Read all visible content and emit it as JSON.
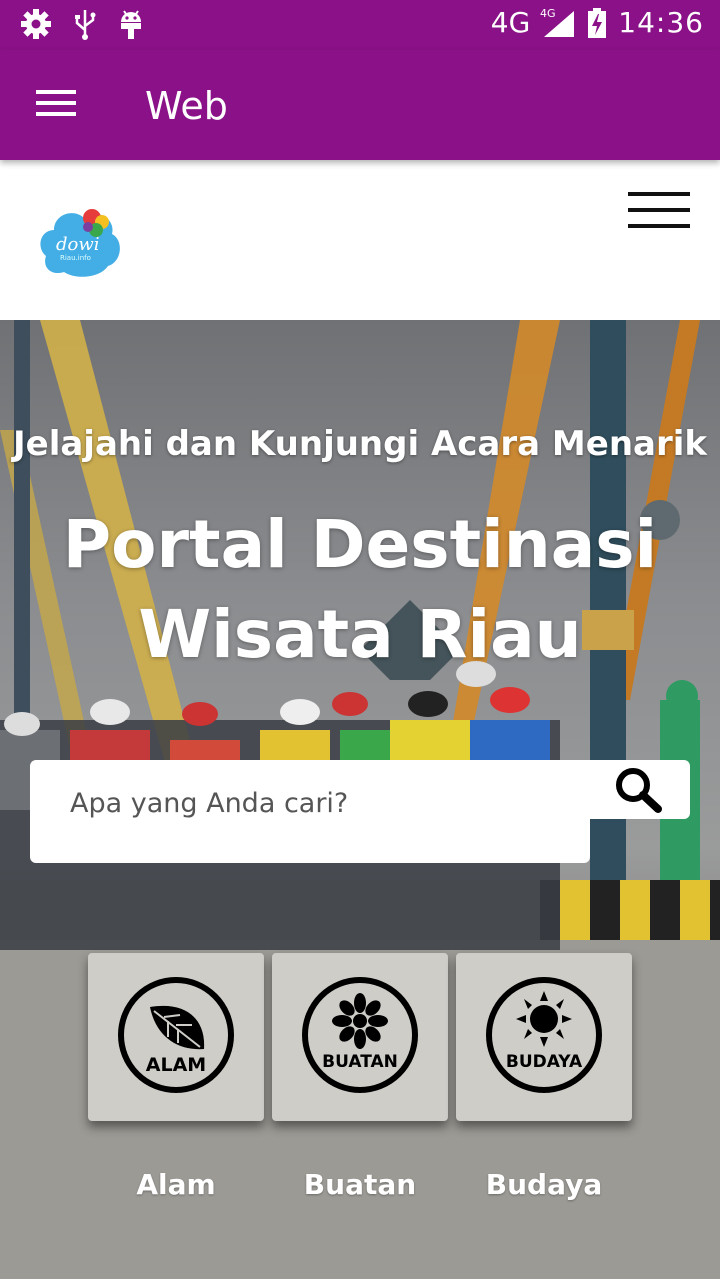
{
  "status_bar": {
    "icons": [
      "settings-icon",
      "usb-icon",
      "android-icon"
    ],
    "network": "4G",
    "network_small": "4G",
    "time": "14:36"
  },
  "app_bar": {
    "title": "Web"
  },
  "site": {
    "logo_text": "dowi",
    "logo_subtext": "Riau.info"
  },
  "hero": {
    "subtitle": "Jelajahi dan Kunjungi Acara Menarik",
    "title_line1": "Portal Destinasi",
    "title_line2": "Wisata Riau"
  },
  "search": {
    "placeholder": "Apa yang Anda cari?"
  },
  "categories": [
    {
      "label": "Alam",
      "badge": "ALAM",
      "icon": "leaf-icon"
    },
    {
      "label": "Buatan",
      "badge": "BUATAN",
      "icon": "flower-icon"
    },
    {
      "label": "Budaya",
      "badge": "BUDAYA",
      "icon": "sun-icon"
    }
  ]
}
